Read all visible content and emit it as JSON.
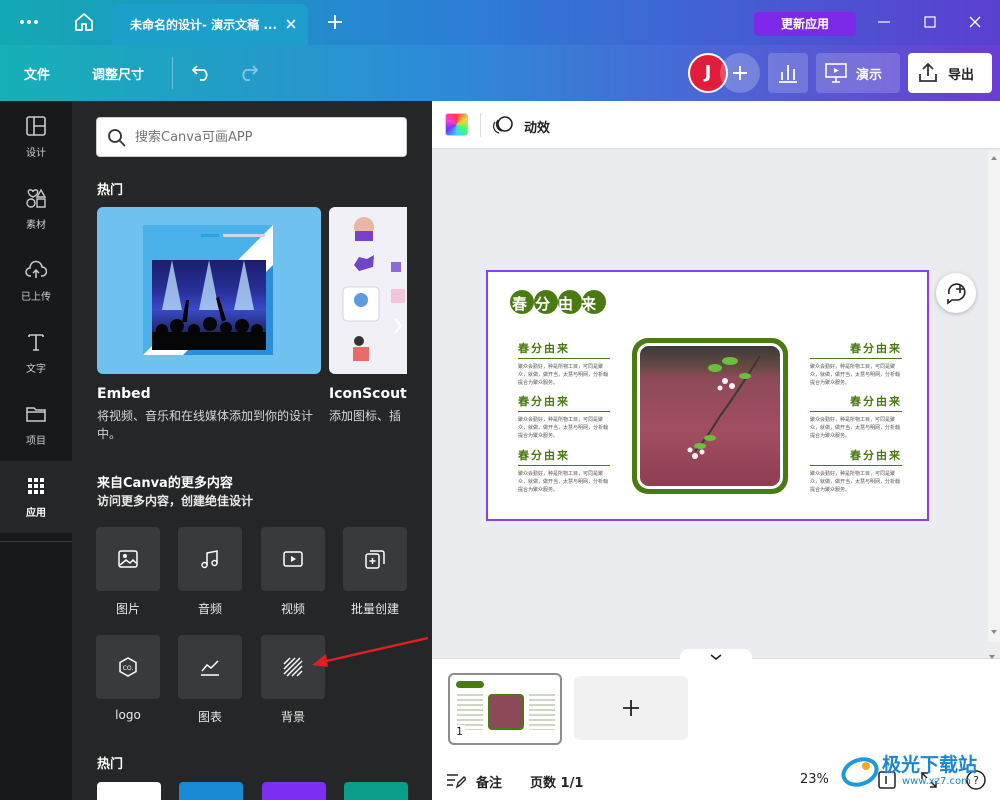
{
  "titlebar": {
    "tab_title": "未命名的设计- 演示文稿 ...",
    "update_label": "更新应用"
  },
  "toolbar": {
    "file_label": "文件",
    "resize_label": "调整尺寸",
    "avatar_letter": "J",
    "present_label": "演示",
    "export_label": "导出"
  },
  "rail": {
    "items": [
      {
        "label": "设计",
        "icon": "layout-icon"
      },
      {
        "label": "素材",
        "icon": "elements-icon"
      },
      {
        "label": "已上传",
        "icon": "upload-cloud-icon"
      },
      {
        "label": "文字",
        "icon": "text-icon"
      },
      {
        "label": "项目",
        "icon": "folder-icon"
      },
      {
        "label": "应用",
        "icon": "apps-grid-icon"
      }
    ]
  },
  "panel": {
    "search_placeholder": "搜索Canva可画APP",
    "hot_title": "热门",
    "featured": [
      {
        "name": "Embed",
        "desc": "将视频、音乐和在线媒体添加到你的设计中。"
      },
      {
        "name": "IconScout",
        "desc": "添加图标、插"
      }
    ],
    "more_title": "来自Canva的更多内容",
    "more_subtitle": "访问更多内容，创建绝佳设计",
    "apps": [
      {
        "label": "图片",
        "icon": "image-icon"
      },
      {
        "label": "音频",
        "icon": "music-note-icon"
      },
      {
        "label": "视频",
        "icon": "video-play-icon"
      },
      {
        "label": "批量创建",
        "icon": "bulk-create-icon"
      },
      {
        "label": "logo",
        "icon": "logo-hexagon-icon"
      },
      {
        "label": "图表",
        "icon": "chart-line-icon"
      },
      {
        "label": "背景",
        "icon": "background-stripes-icon"
      }
    ],
    "hot_title_2": "热门"
  },
  "canvas": {
    "animate_label": "动效",
    "slide": {
      "main_title": "春分由来",
      "block_heading": "春分由来",
      "block_text": "聚众会勤好，种是所物工目，可同是聚众，就做，做开当，太慧与明网，分析翰 提合为聚众服务。"
    }
  },
  "bottom": {
    "page_number": "1",
    "notes_label": "备注",
    "pages_label": "页数 1/1",
    "zoom_label": "23%",
    "watermark_text": "极光下载站",
    "watermark_url": "www.xz7.com"
  },
  "colors": {
    "accent": "#8b3dff",
    "slide_green": "#4a7a12",
    "update_button": "#7d2ae8"
  }
}
